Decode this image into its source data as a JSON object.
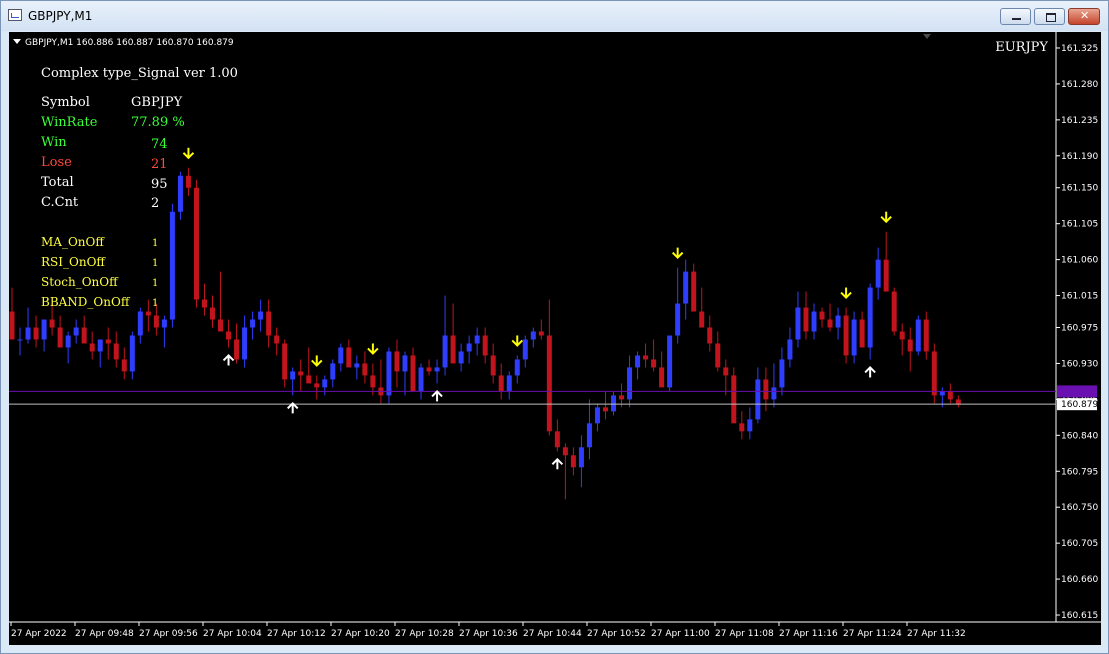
{
  "window": {
    "title": "GBPJPY,M1",
    "app_icon": "chart-window-icon",
    "buttons": [
      "minimize",
      "maximize",
      "close"
    ]
  },
  "chart_header": {
    "info": "GBPJPY,M1  160.886 160.887 160.870 160.879",
    "symbol_label": "EURJPY"
  },
  "panel": {
    "title": "Complex type_Signal ver 1.00",
    "rows": [
      {
        "label": "Symbol",
        "value": "GBPJPY",
        "color": "#ffffff"
      },
      {
        "label": "WinRate",
        "value": "77.89 %",
        "color": "#39ff39"
      },
      {
        "label": "Win",
        "value": "74",
        "color": "#39ff39"
      },
      {
        "label": "Lose",
        "value": "21",
        "color": "#ff4a3a"
      },
      {
        "label": "Total",
        "value": "95",
        "color": "#ffffff"
      },
      {
        "label": "C.Cnt",
        "value": "2",
        "color": "#ffffff"
      }
    ],
    "switches": [
      {
        "label": "MA_OnOff",
        "value": "1"
      },
      {
        "label": "RSI_OnOff",
        "value": "1"
      },
      {
        "label": "Stoch_OnOff",
        "value": "1"
      },
      {
        "label": "BBAND_OnOff",
        "value": "1"
      }
    ],
    "switch_color": "#ffff40"
  },
  "chart_data": {
    "type": "candlestick",
    "symbol": "GBPJPY",
    "timeframe": "M1",
    "ylim": [
      160.6,
      161.34
    ],
    "y_ticks": [
      "161.325",
      "161.280",
      "161.235",
      "161.190",
      "161.150",
      "161.105",
      "161.060",
      "161.015",
      "160.975",
      "160.930",
      "160.885",
      "160.840",
      "160.795",
      "160.750",
      "160.705",
      "160.660",
      "160.615"
    ],
    "x_ticks": [
      "27 Apr 2022",
      "27 Apr 09:48",
      "27 Apr 09:56",
      "27 Apr 10:04",
      "27 Apr 10:12",
      "27 Apr 10:20",
      "27 Apr 10:28",
      "27 Apr 10:36",
      "27 Apr 10:44",
      "27 Apr 10:52",
      "27 Apr 11:00",
      "27 Apr 11:08",
      "27 Apr 11:16",
      "27 Apr 11:24",
      "27 Apr 11:32"
    ],
    "bull_color": "#2f3dff",
    "bear_color": "#c1141c",
    "current_price": 160.879,
    "current_price_label": "160.879",
    "ask_line": 160.895,
    "ask_line_color": "#6a0fb0",
    "candles": [
      [
        160.995,
        161.025,
        160.985,
        160.96
      ],
      [
        160.96,
        160.975,
        160.94,
        160.96
      ],
      [
        160.96,
        161.0,
        160.955,
        160.975
      ],
      [
        160.975,
        160.99,
        160.95,
        160.96
      ],
      [
        160.96,
        160.975,
        160.945,
        160.985
      ],
      [
        160.985,
        161.005,
        160.965,
        160.975
      ],
      [
        160.975,
        160.99,
        160.955,
        160.95
      ],
      [
        160.95,
        160.97,
        160.93,
        160.965
      ],
      [
        160.965,
        160.985,
        160.955,
        160.975
      ],
      [
        160.975,
        160.99,
        160.96,
        160.955
      ],
      [
        160.955,
        160.97,
        160.935,
        160.945
      ],
      [
        160.945,
        160.96,
        160.925,
        160.96
      ],
      [
        160.96,
        160.975,
        160.935,
        160.955
      ],
      [
        160.955,
        160.97,
        160.925,
        160.935
      ],
      [
        160.935,
        160.95,
        160.91,
        160.92
      ],
      [
        160.92,
        160.97,
        160.91,
        160.965
      ],
      [
        160.965,
        161.0,
        160.955,
        160.995
      ],
      [
        160.995,
        161.01,
        160.97,
        160.99
      ],
      [
        160.99,
        161.005,
        160.965,
        160.975
      ],
      [
        160.975,
        160.99,
        160.95,
        160.985
      ],
      [
        160.985,
        161.13,
        160.975,
        161.12
      ],
      [
        161.12,
        161.17,
        161.11,
        161.165
      ],
      [
        161.165,
        161.175,
        161.14,
        161.15
      ],
      [
        161.15,
        161.16,
        161.0,
        161.01
      ],
      [
        161.01,
        161.03,
        160.99,
        161.0
      ],
      [
        161.0,
        161.015,
        160.975,
        160.985
      ],
      [
        160.985,
        161.045,
        160.97,
        160.97
      ],
      [
        160.97,
        160.985,
        160.95,
        160.96
      ],
      [
        160.96,
        160.98,
        160.93,
        160.935
      ],
      [
        160.935,
        160.99,
        160.925,
        160.975
      ],
      [
        160.975,
        160.995,
        160.96,
        160.985
      ],
      [
        160.985,
        161.01,
        160.97,
        160.995
      ],
      [
        160.995,
        161.01,
        160.95,
        160.965
      ],
      [
        160.965,
        160.975,
        160.94,
        160.955
      ],
      [
        160.955,
        160.96,
        160.9,
        160.91
      ],
      [
        160.91,
        160.925,
        160.89,
        160.92
      ],
      [
        160.92,
        160.935,
        160.895,
        160.915
      ],
      [
        160.915,
        160.95,
        160.91,
        160.905
      ],
      [
        160.905,
        160.915,
        160.885,
        160.9
      ],
      [
        160.9,
        160.915,
        160.89,
        160.91
      ],
      [
        160.91,
        160.935,
        160.9,
        160.93
      ],
      [
        160.93,
        160.955,
        160.92,
        160.95
      ],
      [
        160.95,
        160.96,
        160.935,
        160.925
      ],
      [
        160.925,
        160.94,
        160.91,
        160.93
      ],
      [
        160.93,
        160.945,
        160.905,
        160.915
      ],
      [
        160.915,
        160.93,
        160.89,
        160.9
      ],
      [
        160.9,
        160.935,
        160.88,
        160.89
      ],
      [
        160.89,
        160.95,
        160.88,
        160.945
      ],
      [
        160.945,
        160.96,
        160.9,
        160.92
      ],
      [
        160.92,
        160.945,
        160.89,
        160.94
      ],
      [
        160.94,
        160.95,
        160.93,
        160.895
      ],
      [
        160.895,
        160.93,
        160.885,
        160.925
      ],
      [
        160.925,
        160.935,
        160.915,
        160.92
      ],
      [
        160.92,
        160.935,
        160.905,
        160.925
      ],
      [
        160.925,
        161.015,
        160.915,
        160.965
      ],
      [
        160.965,
        161.005,
        160.94,
        160.93
      ],
      [
        160.93,
        160.955,
        160.92,
        160.945
      ],
      [
        160.945,
        160.965,
        160.93,
        160.955
      ],
      [
        160.955,
        160.975,
        160.94,
        160.965
      ],
      [
        160.965,
        160.975,
        160.93,
        160.94
      ],
      [
        160.94,
        160.955,
        160.905,
        160.915
      ],
      [
        160.915,
        160.93,
        160.885,
        160.895
      ],
      [
        160.895,
        160.92,
        160.885,
        160.915
      ],
      [
        160.915,
        160.94,
        160.905,
        160.935
      ],
      [
        160.935,
        160.965,
        160.925,
        160.96
      ],
      [
        160.96,
        160.975,
        160.95,
        160.97
      ],
      [
        160.97,
        160.985,
        160.96,
        160.965
      ],
      [
        160.965,
        161.01,
        160.84,
        160.845
      ],
      [
        160.845,
        160.86,
        160.82,
        160.825
      ],
      [
        160.825,
        160.83,
        160.76,
        160.815
      ],
      [
        160.815,
        160.825,
        160.79,
        160.8
      ],
      [
        160.8,
        160.84,
        160.775,
        160.825
      ],
      [
        160.825,
        160.885,
        160.81,
        160.855
      ],
      [
        160.855,
        160.88,
        160.845,
        160.875
      ],
      [
        160.875,
        160.895,
        160.86,
        160.87
      ],
      [
        160.87,
        160.895,
        160.865,
        160.89
      ],
      [
        160.89,
        160.905,
        160.875,
        160.885
      ],
      [
        160.885,
        160.94,
        160.875,
        160.925
      ],
      [
        160.925,
        160.945,
        160.91,
        160.94
      ],
      [
        160.94,
        160.955,
        160.925,
        160.935
      ],
      [
        160.935,
        160.96,
        160.92,
        160.925
      ],
      [
        160.925,
        160.945,
        160.91,
        160.9
      ],
      [
        160.9,
        160.94,
        160.895,
        160.965
      ],
      [
        160.965,
        161.05,
        160.955,
        161.005
      ],
      [
        161.005,
        161.06,
        160.985,
        161.045
      ],
      [
        161.045,
        161.055,
        161.0,
        160.995
      ],
      [
        160.995,
        161.025,
        160.98,
        160.975
      ],
      [
        160.975,
        160.99,
        160.945,
        160.955
      ],
      [
        160.955,
        160.97,
        160.92,
        160.925
      ],
      [
        160.925,
        160.935,
        160.89,
        160.915
      ],
      [
        160.915,
        160.925,
        160.89,
        160.855
      ],
      [
        160.855,
        160.87,
        160.835,
        160.845
      ],
      [
        160.845,
        160.875,
        160.835,
        160.86
      ],
      [
        160.86,
        160.925,
        160.855,
        160.91
      ],
      [
        160.91,
        160.925,
        160.87,
        160.885
      ],
      [
        160.885,
        160.93,
        160.875,
        160.9
      ],
      [
        160.9,
        160.95,
        160.89,
        160.935
      ],
      [
        160.935,
        160.975,
        160.925,
        160.96
      ],
      [
        160.96,
        161.02,
        160.95,
        161.0
      ],
      [
        161.0,
        161.02,
        160.96,
        160.97
      ],
      [
        160.97,
        161.005,
        160.96,
        160.995
      ],
      [
        160.995,
        161.0,
        160.975,
        160.985
      ],
      [
        160.985,
        161.005,
        160.97,
        160.975
      ],
      [
        160.975,
        161.0,
        160.96,
        160.99
      ],
      [
        160.99,
        161.0,
        160.93,
        160.94
      ],
      [
        160.94,
        160.995,
        160.93,
        160.985
      ],
      [
        160.985,
        160.995,
        160.955,
        160.95
      ],
      [
        160.95,
        161.03,
        160.935,
        161.025
      ],
      [
        161.025,
        161.075,
        161.01,
        161.06
      ],
      [
        161.06,
        161.095,
        161.06,
        161.02
      ],
      [
        161.02,
        161.025,
        160.965,
        160.97
      ],
      [
        160.97,
        160.98,
        160.94,
        160.96
      ],
      [
        160.96,
        160.975,
        160.92,
        160.945
      ],
      [
        160.945,
        160.99,
        160.94,
        160.985
      ],
      [
        160.985,
        160.995,
        160.935,
        160.945
      ],
      [
        160.945,
        160.955,
        160.88,
        160.89
      ],
      [
        160.89,
        160.9,
        160.875,
        160.895
      ],
      [
        160.895,
        160.905,
        160.88,
        160.885
      ],
      [
        160.885,
        160.89,
        160.875,
        160.879
      ]
    ],
    "signals": [
      {
        "type": "sell",
        "bar": 22
      },
      {
        "type": "buy",
        "bar": 27
      },
      {
        "type": "buy",
        "bar": 35
      },
      {
        "type": "sell",
        "bar": 38
      },
      {
        "type": "sell",
        "bar": 45
      },
      {
        "type": "buy",
        "bar": 53
      },
      {
        "type": "sell",
        "bar": 63
      },
      {
        "type": "buy",
        "bar": 68
      },
      {
        "type": "sell",
        "bar": 83
      },
      {
        "type": "sell",
        "bar": 104
      },
      {
        "type": "sell",
        "bar": 109
      },
      {
        "type": "buy",
        "bar": 107
      }
    ],
    "sell_arrow_color": "#ffff00",
    "buy_arrow_color": "#ffffff"
  }
}
